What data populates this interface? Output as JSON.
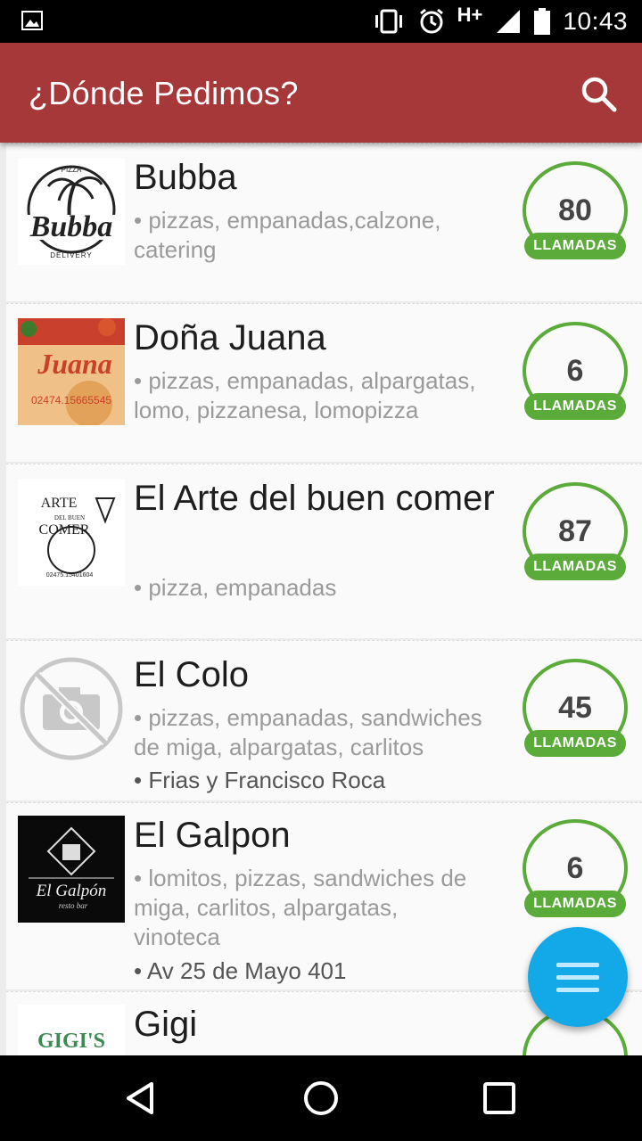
{
  "status_bar": {
    "time": "10:43",
    "network": "H+",
    "icons": [
      "image-icon",
      "vibrate-icon",
      "alarm-icon",
      "signal-icon",
      "battery-icon"
    ]
  },
  "app_bar": {
    "title": "¿Dónde Pedimos?",
    "search_icon": "search-icon"
  },
  "colors": {
    "app_bar": "#a6383a",
    "badge_green": "#5bab3a",
    "fab_blue": "#13a9e8"
  },
  "restaurants": [
    {
      "name": "Bubba",
      "tags": "• pizzas, empanadas,calzone, catering",
      "address": "",
      "calls": "80",
      "calls_label": "LLAMADAS",
      "logo": {
        "text_top": "PIZZA",
        "brand": "Bubba",
        "sub": "DELIVERY"
      }
    },
    {
      "name": "Doña Juana",
      "tags": "• pizzas, empanadas, alpargatas, lomo, pizzanesa, lomopizza",
      "address": "",
      "calls": "6",
      "calls_label": "LLAMADAS",
      "logo": {
        "brand": "Juana",
        "phone": "02474.15665545"
      }
    },
    {
      "name": "El Arte del buen comer",
      "tags": "• pizza, empanadas",
      "address": "",
      "calls": "87",
      "calls_label": "LLAMADAS",
      "logo": {
        "line1": "ARTE",
        "line2": "DEL BUEN",
        "line3": "COMER",
        "phone": "02475.15401604"
      }
    },
    {
      "name": "El Colo",
      "tags": "• pizzas, empanadas, sandwiches de miga, alpargatas, carlitos",
      "address": "• Frias y Francisco Roca",
      "calls": "45",
      "calls_label": "LLAMADAS",
      "logo": {
        "icon": "no-camera-icon"
      }
    },
    {
      "name": "El Galpon",
      "tags": "• lomitos, pizzas, sandwiches de miga, carlitos, alpargatas, vinoteca",
      "address": "• Av 25 de Mayo 401",
      "calls": "6",
      "calls_label": "LLAMADAS",
      "logo": {
        "brand": "El Galpón",
        "sub": "resto bar"
      }
    },
    {
      "name": "Gigi",
      "tags": "",
      "address": "",
      "calls": "",
      "calls_label": "",
      "logo": {
        "brand": "GIGI'S"
      }
    }
  ],
  "fab": {
    "icon": "menu-icon"
  },
  "nav_bar": {
    "icons": [
      "back-icon",
      "home-icon",
      "recents-icon"
    ]
  }
}
